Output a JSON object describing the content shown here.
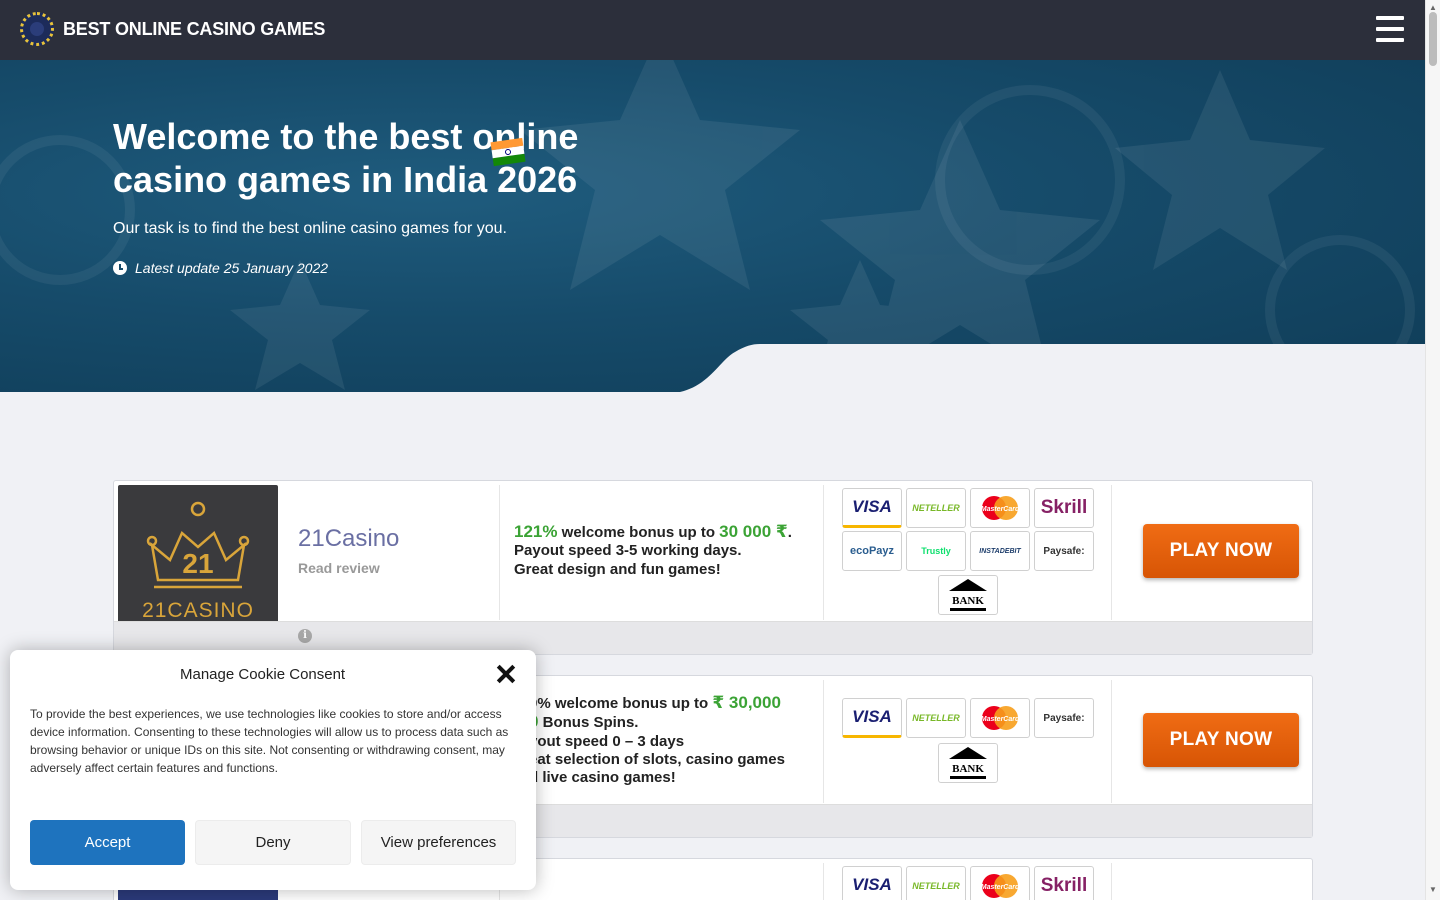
{
  "header": {
    "brand": "BEST ONLINE CASINO GAMES",
    "menu_icon": "hamburger-menu-icon",
    "background": "#2c2f3b"
  },
  "hero": {
    "title": "Welcome to the best online casino games in India 2026",
    "subtitle": "Our task is to find the best online casino games for you.",
    "update": "Latest update 25 January 2022",
    "flag_icon": "india-flag-icon"
  },
  "casinos": [
    {
      "name": "21Casino",
      "logo_text": "21CASINO",
      "review_label": "Read review",
      "bonus_pct": "121%",
      "bonus_mid": " welcome bonus up to ",
      "bonus_amt": "30 000 ₹",
      "bonus_end": ".",
      "line2": "Payout speed 3-5 working days.",
      "line3": "Great design and fun games!",
      "payments": [
        "VISA",
        "NETELLER",
        "MasterCard",
        "Skrill",
        "ecoPayz",
        "Trustly",
        "INSTADEBIT",
        "Paysafe:",
        "BANK"
      ],
      "cta": "PLAY NOW"
    },
    {
      "bonus_pct": "0%",
      "bonus_mid": " welcome bonus up to ",
      "bonus_amt": "₹ 30,000",
      "line2_prefix": "0",
      "line2": " Bonus Spins.",
      "line3": "yout speed 0 – 3 days",
      "line4": "eat selection of slots, casino games",
      "line5": "d live casino games!",
      "payments": [
        "VISA",
        "NETELLER",
        "MasterCard",
        "Paysafe:",
        "BANK"
      ],
      "cta": "PLAY NOW"
    },
    {
      "payments": [
        "VISA",
        "NETELLER",
        "MasterCard",
        "Skrill"
      ]
    }
  ],
  "cookie": {
    "title": "Manage Cookie Consent",
    "text": "To provide the best experiences, we use technologies like cookies to store and/or access device information. Consenting to these technologies will allow us to process data such as browsing behavior or unique IDs on this site. Not consenting or withdrawing consent, may adversely affect certain features and functions.",
    "accept": "Accept",
    "deny": "Deny",
    "preferences": "View preferences"
  },
  "colors": {
    "accent_green": "#3ba335",
    "play_orange": "#f06c14",
    "accept_blue": "#1e73be",
    "casino_name": "#6a6fa3"
  }
}
